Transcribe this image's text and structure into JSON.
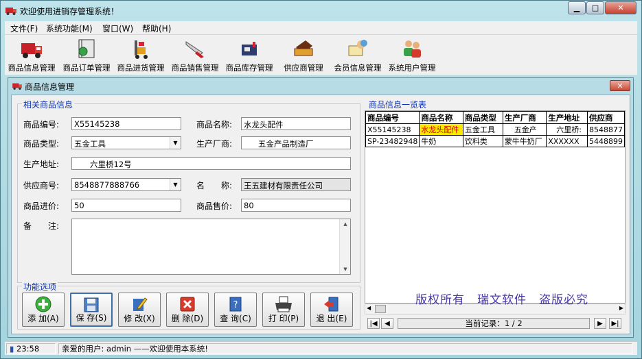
{
  "window": {
    "title": "欢迎使用进销存管理系统！"
  },
  "menu": [
    "文件(F)",
    "系统功能(M)",
    "窗口(W)",
    "帮助(H)"
  ],
  "toolbar": [
    {
      "label": "商品信息管理",
      "icon": "truck-icon"
    },
    {
      "label": "商品订单管理",
      "icon": "book-icon"
    },
    {
      "label": "商品进货管理",
      "icon": "forklift-icon"
    },
    {
      "label": "商品销售管理",
      "icon": "knife-icon"
    },
    {
      "label": "商品库存管理",
      "icon": "warehouse-icon"
    },
    {
      "label": "供应商管理",
      "icon": "printer-icon"
    },
    {
      "label": "会员信息管理",
      "icon": "user-card-icon"
    },
    {
      "label": "系统用户管理",
      "icon": "users-icon"
    }
  ],
  "child": {
    "title": "商品信息管理"
  },
  "form": {
    "group_title": "相关商品信息",
    "code_label": "商品编号:",
    "code_value": "X55145238",
    "name_label": "商品名称:",
    "name_value": "水龙头配件",
    "type_label": "商品类型:",
    "type_value": "五金工具",
    "maker_label": "生产厂商:",
    "maker_value": "五金产品制造厂",
    "addr_label": "生产地址:",
    "addr_value": "六里桥12号",
    "supplier_label": "供应商号:",
    "supplier_value": "8548877888766",
    "sname_label": "名　　称:",
    "sname_value": "王五建材有限责任公司",
    "inprice_label": "商品进价:",
    "inprice_value": "50",
    "outprice_label": "商品售价:",
    "outprice_value": "80",
    "note_label": "备　　注:"
  },
  "functions": {
    "group_title": "功能选项",
    "buttons": [
      {
        "label": "添 加(A)",
        "icon": "add-icon"
      },
      {
        "label": "保 存(S)",
        "icon": "save-icon"
      },
      {
        "label": "修 改(X)",
        "icon": "edit-icon"
      },
      {
        "label": "删 除(D)",
        "icon": "delete-icon"
      },
      {
        "label": "查 询(C)",
        "icon": "query-icon"
      },
      {
        "label": "打 印(P)",
        "icon": "print-icon"
      },
      {
        "label": "退 出(E)",
        "icon": "exit-icon"
      }
    ]
  },
  "list": {
    "group_title": "商品信息一览表",
    "columns": [
      "商品编号",
      "商品名称",
      "商品类型",
      "生产厂商",
      "生产地址",
      "供应商"
    ],
    "rows": [
      [
        "X55145238",
        "水龙头配件",
        "五金工具",
        "五金产",
        "六里桥:",
        "8548877"
      ],
      [
        "SP-23482948",
        "牛奶",
        "饮料类",
        "蒙牛牛奶厂",
        "XXXXXX",
        "5448899"
      ]
    ],
    "record_text": "当前记录：1 / 2"
  },
  "copyright": "版权所有　瑞文软件　盗版必究",
  "status": {
    "time": "23:58",
    "message": "亲爱的用户: admin ——欢迎使用本系统!"
  },
  "colors": {
    "legend": "#0b33b3",
    "selected_bg": "#ffe800",
    "selected_fg": "#d40000",
    "copyright": "#4a3aa8"
  }
}
